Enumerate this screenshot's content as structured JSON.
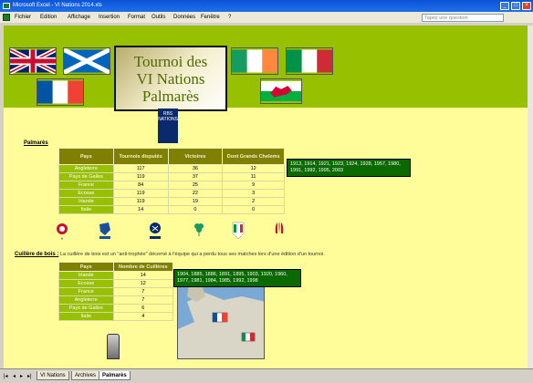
{
  "window": {
    "title": "Microsoft Excel - VI Nations 2014.xls"
  },
  "menu": {
    "items": [
      "Fichier",
      "Edition",
      "Affichage",
      "Insertion",
      "Format",
      "Outils",
      "Données",
      "Fenêtre",
      "?"
    ],
    "question_placeholder": "Tapez une question"
  },
  "banner": {
    "title": "Tournoi des\nVI Nations\nPalmarès"
  },
  "logo": {
    "text": "RBS NATIONS"
  },
  "palmares": {
    "label": "Palmarès",
    "headers": [
      "Pays",
      "Tournois disputés",
      "Victoires",
      "Dont Grands Chelems"
    ],
    "rows": [
      {
        "pays": "Angleterre",
        "tournois": "117",
        "victoires": "36",
        "gc": "12"
      },
      {
        "pays": "Pays de Galles",
        "tournois": "119",
        "victoires": "37",
        "gc": "11"
      },
      {
        "pays": "France",
        "tournois": "84",
        "victoires": "25",
        "gc": "9"
      },
      {
        "pays": "Ecosse",
        "tournois": "119",
        "victoires": "22",
        "gc": "3"
      },
      {
        "pays": "Irlande",
        "tournois": "119",
        "victoires": "19",
        "gc": "2"
      },
      {
        "pays": "Italie",
        "tournois": "14",
        "victoires": "0",
        "gc": "0"
      }
    ],
    "note": "1913, 1914, 1921, 1923, 1924, 1928, 1957, 1980, 1991, 1992, 1995, 2003"
  },
  "cuillere": {
    "label": "Cuillère de bois :",
    "description": "La cuillère de bois est un \"anti-trophée\" décerné à l'équipe qui a perdu tous ses matches lors d'une édition d'un tournoi.",
    "headers": [
      "Pays",
      "Nombre de Cuillères"
    ],
    "rows": [
      {
        "pays": "Irlande",
        "n": "14"
      },
      {
        "pays": "Ecosse",
        "n": "12"
      },
      {
        "pays": "France",
        "n": "7"
      },
      {
        "pays": "Angleterre",
        "n": "7"
      },
      {
        "pays": "Pays de Galles",
        "n": "6"
      },
      {
        "pays": "Italie",
        "n": "4"
      }
    ],
    "note": "1904, 1885, 1886, 1891, 1895, 1903, 1920, 1960, 1977, 1981, 1984, 1985, 1992, 1998"
  },
  "sheet_tabs": [
    "VI Nations",
    "Archives",
    "Palmarès"
  ],
  "emblems": [
    "england-emblem",
    "france-emblem",
    "scotland-emblem",
    "ireland-emblem",
    "italy-emblem",
    "wales-emblem"
  ],
  "colors": {
    "green": "#97c000",
    "olive": "#808000",
    "yellow": "#fffd99"
  }
}
